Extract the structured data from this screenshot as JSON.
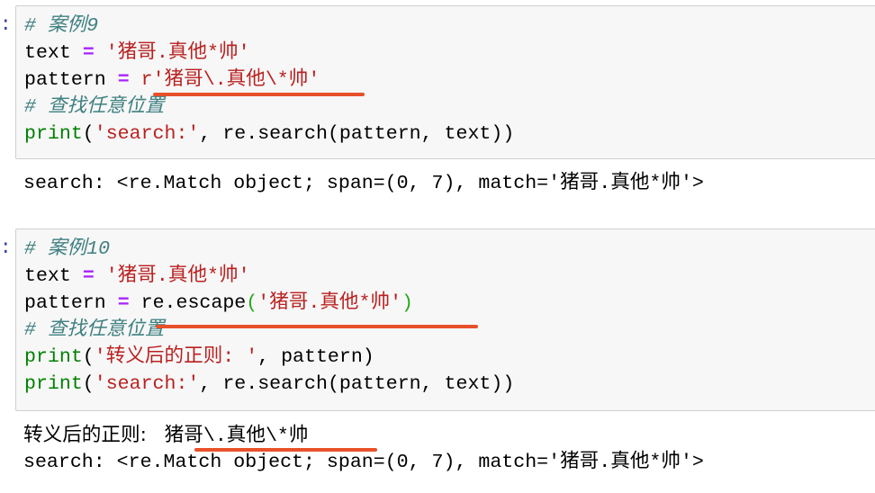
{
  "notebook": {
    "cells": [
      {
        "prompt": ":",
        "code": {
          "comment1": "# 案例9",
          "line_text": {
            "var": "text",
            "op": "=",
            "str": "'猪哥.真他*帅'"
          },
          "line_pattern": {
            "var": "pattern",
            "op": "=",
            "str": "r'猪哥\\.真他\\*帅'"
          },
          "comment2": "# 查找任意位置",
          "line_print": {
            "fn": "print",
            "open": "(",
            "str": "'search:'",
            "rest": ", re.search(pattern, text))"
          }
        },
        "output": [
          "search: <re.Match object; span=(0, 7), match='猪哥.真他*帅'>"
        ]
      },
      {
        "prompt": ":",
        "code": {
          "comment1": "# 案例10",
          "line_text": {
            "var": "text",
            "op": "=",
            "str": "'猪哥.真他*帅'"
          },
          "line_pattern": {
            "var": "pattern",
            "op": "=",
            "call": "re.escape",
            "open": "(",
            "str": "'猪哥.真他*帅'",
            "close": ")"
          },
          "comment2": "# 查找任意位置",
          "line_print1": {
            "fn": "print",
            "open": "(",
            "str": "'转义后的正则: '",
            "rest": ", pattern)"
          },
          "line_print2": {
            "fn": "print",
            "open": "(",
            "str": "'search:'",
            "rest": ", re.search(pattern, text))"
          }
        },
        "output": {
          "label": "转义后的正则: ",
          "value": "猪哥\\.真他\\*帅",
          "search": "search: <re.Match object; span=(0, 7), match='猪哥.真他*帅'>"
        }
      }
    ],
    "colors": {
      "comment": "#408080",
      "operator": "#aa22ff",
      "string": "#ba2121",
      "builtin": "#008000",
      "highlight_underline": "#e8512a"
    }
  }
}
